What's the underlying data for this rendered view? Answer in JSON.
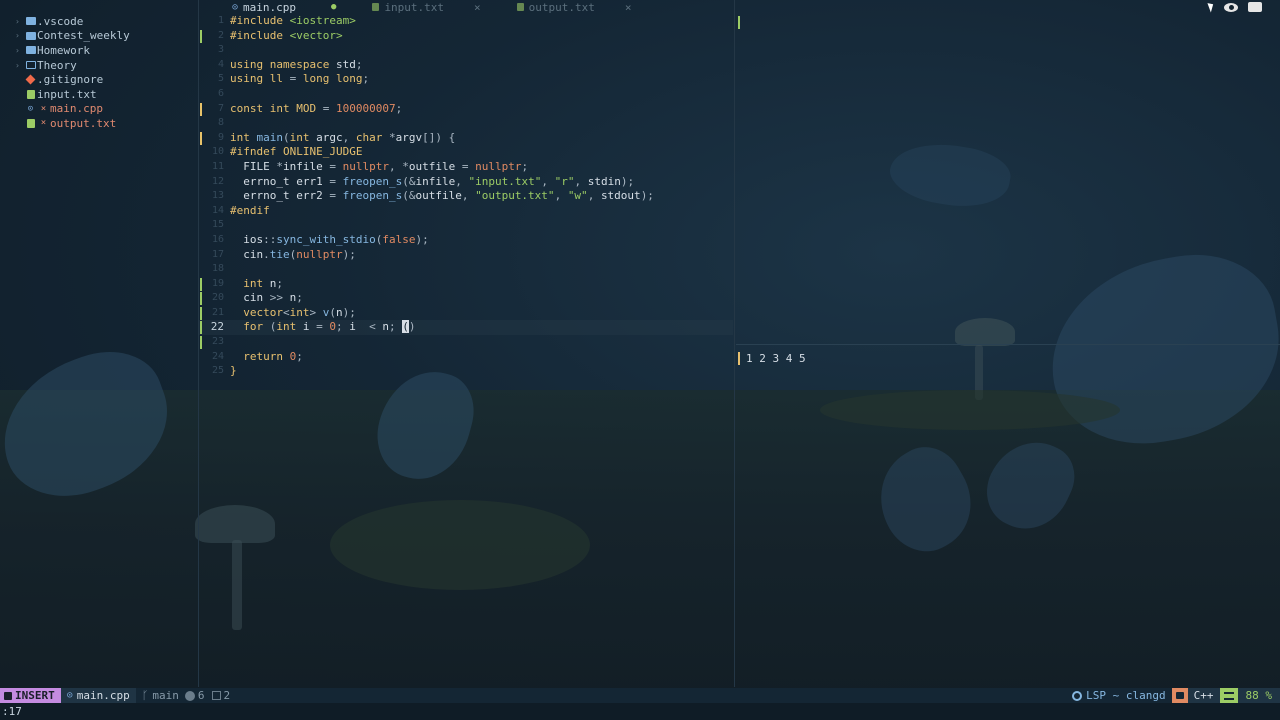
{
  "sidebar": {
    "items": [
      {
        "label": ".vscode",
        "kind": "folder",
        "expandable": true,
        "modified": false
      },
      {
        "label": "Contest_weekly",
        "kind": "folder",
        "expandable": true,
        "modified": false
      },
      {
        "label": "Homework",
        "kind": "folder",
        "expandable": true,
        "modified": false
      },
      {
        "label": "Theory",
        "kind": "folder-open",
        "expandable": true,
        "modified": false
      },
      {
        "label": ".gitignore",
        "kind": "git",
        "expandable": false,
        "modified": false
      },
      {
        "label": "input.txt",
        "kind": "txt",
        "expandable": false,
        "modified": false
      },
      {
        "label": "main.cpp",
        "kind": "cpp",
        "expandable": false,
        "modified": true,
        "marker": "×"
      },
      {
        "label": "output.txt",
        "kind": "txt",
        "expandable": false,
        "modified": true,
        "marker": "×"
      }
    ]
  },
  "tabs": [
    {
      "label": "main.cpp",
      "active": true,
      "indicator": "●"
    },
    {
      "label": "input.txt",
      "active": false,
      "indicator": "×"
    },
    {
      "label": "output.txt",
      "active": false,
      "indicator": "×"
    }
  ],
  "editor": {
    "current_line": "22",
    "lines": [
      {
        "n": "1"
      },
      {
        "n": "2"
      },
      {
        "n": "3"
      },
      {
        "n": "4"
      },
      {
        "n": "5"
      },
      {
        "n": "6"
      },
      {
        "n": "7"
      },
      {
        "n": "8"
      },
      {
        "n": "9"
      },
      {
        "n": "10"
      },
      {
        "n": "11"
      },
      {
        "n": "12"
      },
      {
        "n": "13"
      },
      {
        "n": "14"
      },
      {
        "n": "15"
      },
      {
        "n": "16"
      },
      {
        "n": "17"
      },
      {
        "n": "18"
      },
      {
        "n": "19"
      },
      {
        "n": "20"
      },
      {
        "n": "21"
      },
      {
        "n": "22"
      },
      {
        "n": "23"
      },
      {
        "n": "24"
      },
      {
        "n": "25"
      }
    ],
    "code": {
      "l1": [
        "#include",
        " ",
        "<iostream>"
      ],
      "l2": [
        "#include",
        " ",
        "<vector>"
      ],
      "l4": [
        "using",
        " ",
        "namespace",
        " ",
        "std",
        ";"
      ],
      "l5": [
        "using",
        " ",
        "ll",
        " = ",
        "long",
        " ",
        "long",
        ";"
      ],
      "l7": [
        "const",
        " ",
        "int",
        " ",
        "MOD",
        " = ",
        "100000007",
        ";"
      ],
      "l9": [
        "int",
        " ",
        "main",
        "(",
        "int",
        " ",
        "argc",
        ", ",
        "char",
        " *",
        "argv",
        "[]) {"
      ],
      "l10": [
        "#ifndef",
        " ",
        "ONLINE_JUDGE"
      ],
      "l11": [
        "  ",
        "FILE",
        " *",
        "infile",
        " = ",
        "nullptr",
        ", *",
        "outfile",
        " = ",
        "nullptr",
        ";"
      ],
      "l12": [
        "  ",
        "errno_t",
        " ",
        "err1",
        " = ",
        "freopen_s",
        "(&",
        "infile",
        ", ",
        "\"input.txt\"",
        ", ",
        "\"r\"",
        ", ",
        "stdin",
        ");"
      ],
      "l13": [
        "  ",
        "errno_t",
        " ",
        "err2",
        " = ",
        "freopen_s",
        "(&",
        "outfile",
        ", ",
        "\"output.txt\"",
        ", ",
        "\"w\"",
        ", ",
        "stdout",
        ");"
      ],
      "l14": [
        "#endif"
      ],
      "l16": [
        "  ",
        "ios",
        "::",
        "sync_with_stdio",
        "(",
        "false",
        ");"
      ],
      "l17": [
        "  ",
        "cin",
        ".",
        "tie",
        "(",
        "nullptr",
        ");"
      ],
      "l19": [
        "  ",
        "int",
        " ",
        "n",
        ";"
      ],
      "l20": [
        "  ",
        "cin",
        " >> ",
        "n",
        ";"
      ],
      "l21": [
        "  ",
        "vector",
        "<",
        "int",
        "> ",
        "v",
        "(",
        "n",
        ");"
      ],
      "l22": [
        "  ",
        "for",
        " (",
        "int",
        " ",
        "i",
        " = ",
        "0",
        "; ",
        "i",
        "  < ",
        "n",
        "; ",
        "(",
        ")"
      ],
      "l24": [
        "  ",
        "return",
        " ",
        "0",
        ";"
      ],
      "l25": [
        "}"
      ]
    }
  },
  "output_pane": {
    "text": "1 2 3 4 5"
  },
  "statusline": {
    "mode": "INSERT",
    "file": "main.cpp",
    "branch": "main",
    "errors": "6",
    "warnings": "2",
    "lsp": "LSP ~ clangd",
    "language": "C++",
    "percent": "88 %"
  },
  "cmdline": ":17",
  "icons": {
    "folder": "folder-icon",
    "git": "git-icon",
    "txt": "text-file-icon",
    "cpp": "cpp-file-icon",
    "branch": "git-branch-icon",
    "error": "error-icon",
    "warning": "warning-icon",
    "lsp": "gear-icon"
  },
  "colors": {
    "background": "#13232f",
    "keyword": "#e7c06f",
    "string": "#9ccc65",
    "number": "#e08a62",
    "function": "#86b7e0",
    "mode_insert": "#c48be0",
    "modified": "#e0896f"
  }
}
